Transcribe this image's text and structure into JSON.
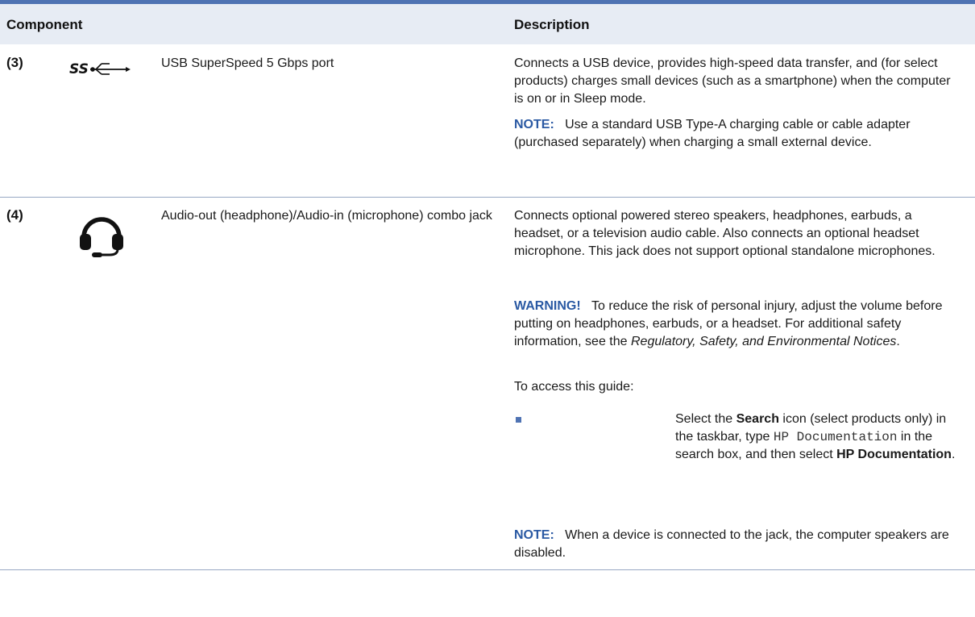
{
  "header": {
    "component": "Component",
    "description": "Description"
  },
  "rows": [
    {
      "number": "(3)",
      "icon": "usb-superspeed-icon",
      "icon_text": "SS",
      "name": "USB SuperSpeed 5 Gbps port",
      "description": "Connects a USB device, provides high-speed data transfer, and (for select products) charges small devices (such as a smartphone) when the computer is on or in Sleep mode.",
      "note": {
        "label": "NOTE:",
        "text": "Use a standard USB Type-A charging cable or cable adapter (purchased separately) when charging a small external device."
      }
    },
    {
      "number": "(4)",
      "icon": "headphone-icon",
      "name": "Audio-out (headphone)/Audio-in (microphone) combo jack",
      "description": "Connects optional powered stereo speakers, headphones, earbuds, a headset, or a television audio cable. Also connects an optional headset microphone. This jack does not support optional standalone microphones.",
      "warning": {
        "label": "WARNING!",
        "text": "To reduce the risk of personal injury, adjust the volume before putting on headphones, earbuds, or a headset. For additional safety information, see the",
        "guide_title": "Regulatory, Safety, and Environmental Notices",
        "end": "."
      },
      "access_intro": "To access this guide:",
      "bullet": {
        "t1": "Select the ",
        "b1": "Search",
        "t2": " icon (select products only) in the taskbar, type ",
        "code": "HP Documentation",
        "t3": " in the search box, and then select ",
        "b2": "HP Documentation",
        "t4": "."
      },
      "note": {
        "label": "NOTE:",
        "text": "When a device is connected to the jack, the computer speakers are disabled."
      }
    }
  ],
  "colors": {
    "accent": "#4f73b3",
    "header_bg": "#e7ecf4",
    "note_label": "#2a59a3"
  }
}
